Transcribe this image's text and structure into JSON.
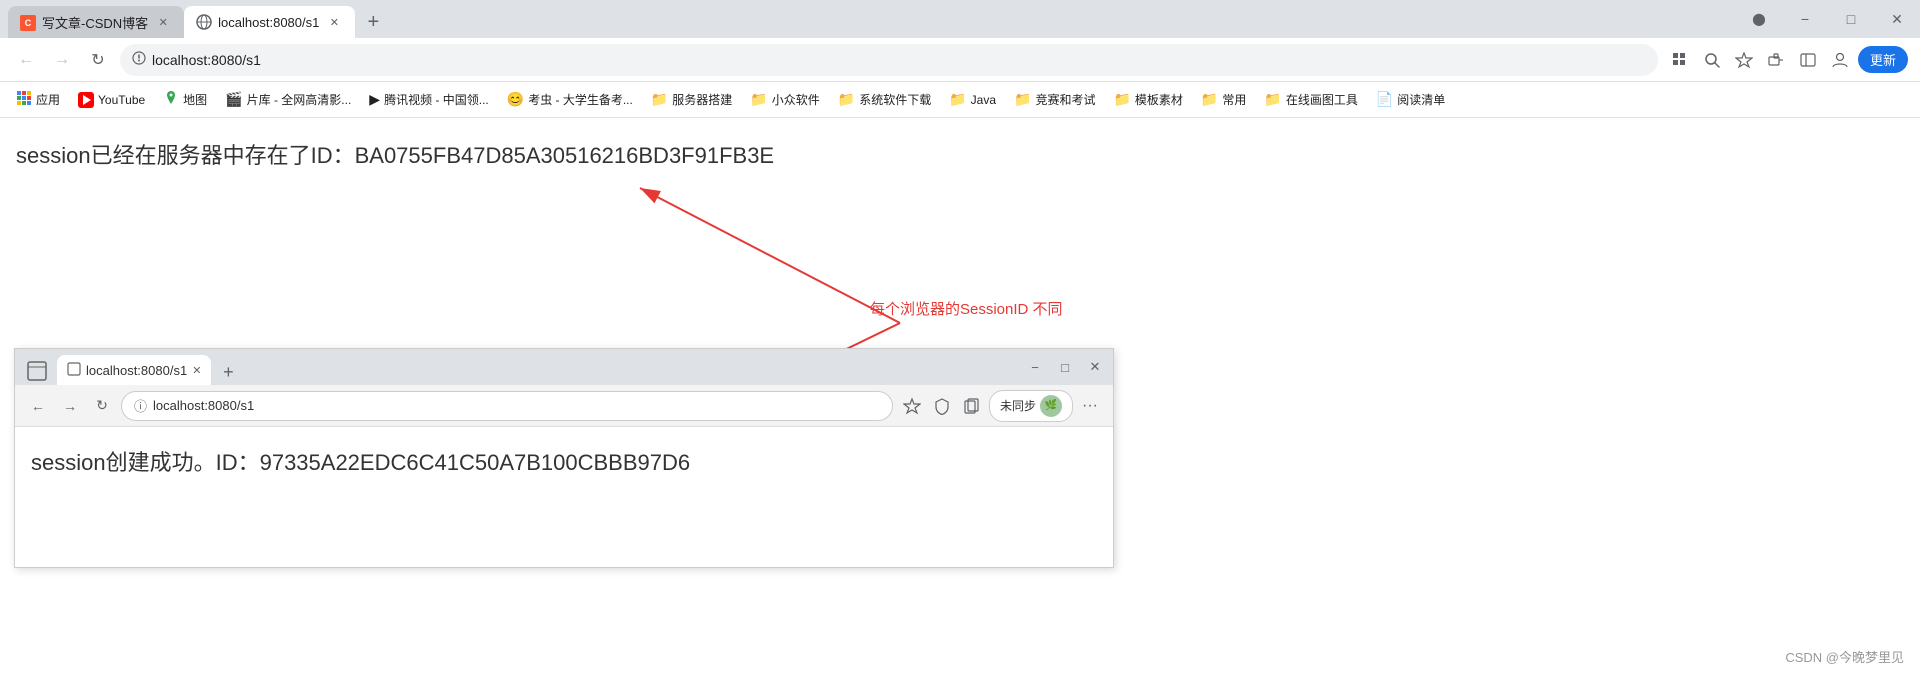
{
  "browser": {
    "tabs": [
      {
        "id": "tab1",
        "favicon": "csdn",
        "title": "写文章-CSDN博客",
        "active": false,
        "url": ""
      },
      {
        "id": "tab2",
        "favicon": "globe",
        "title": "localhost:8080/s1",
        "active": true,
        "url": "localhost:8080/s1"
      }
    ],
    "new_tab_label": "+",
    "nav": {
      "back": "←",
      "forward": "→",
      "reload": "↻"
    },
    "url": "localhost:8080/s1",
    "address_icons": {
      "grid": "⊞",
      "zoom": "🔍",
      "star": "☆",
      "extensions": "🧩",
      "account": "👤",
      "sidebar": "⊟"
    },
    "update_button": "更新",
    "window_controls": {
      "minimize": "−",
      "maximize": "□",
      "close": "✕"
    },
    "bookmarks": [
      {
        "type": "icon",
        "favicon": "apps",
        "label": "应用"
      },
      {
        "type": "youtube",
        "label": "YouTube"
      },
      {
        "type": "folder",
        "label": "地图"
      },
      {
        "type": "folder",
        "label": "片库 - 全网高清影..."
      },
      {
        "type": "folder",
        "label": "腾讯视频 - 中国领..."
      },
      {
        "type": "folder",
        "label": "考虫 - 大学生备考..."
      },
      {
        "type": "folder",
        "label": "服务器搭建"
      },
      {
        "type": "folder",
        "label": "小众软件"
      },
      {
        "type": "folder",
        "label": "系统软件下载"
      },
      {
        "type": "folder",
        "label": "Java"
      },
      {
        "type": "folder",
        "label": "竞赛和考试"
      },
      {
        "type": "folder",
        "label": "模板素材"
      },
      {
        "type": "folder",
        "label": "常用"
      },
      {
        "type": "folder",
        "label": "在线画图工具"
      },
      {
        "type": "folder",
        "label": "阅读清单"
      }
    ]
  },
  "main": {
    "session_text": "session已经在服务器中存在了ID：BA0755FB47D85A30516216BD3F91FB3E",
    "annotation_label": "每个浏览器的SessionID 不同",
    "annotation_color": "#e53935"
  },
  "inner_browser": {
    "tab_title": "localhost:8080/s1",
    "url": "localhost:8080/s1",
    "nav": {
      "back": "←",
      "forward": "→",
      "reload": "↻"
    },
    "window_controls": {
      "minimize": "−",
      "maximize": "□",
      "close": "✕"
    },
    "sync_label": "未同步",
    "more_label": "···",
    "session_text": "session创建成功。ID：97335A22EDC6C41C50A7B100CBBB97D6"
  },
  "watermark": "CSDN @今晚梦里见"
}
